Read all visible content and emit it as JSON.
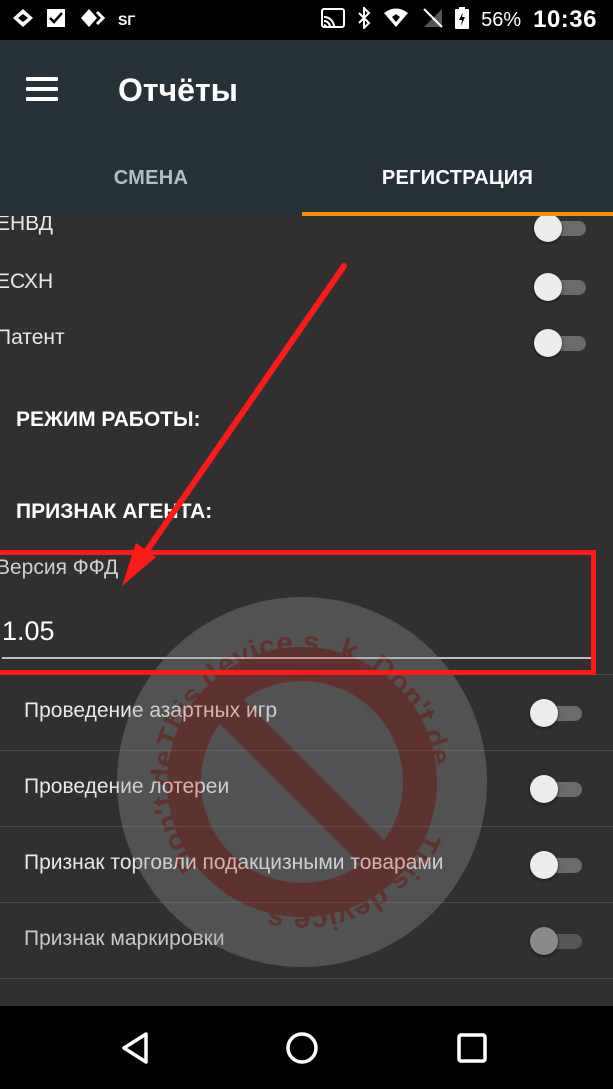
{
  "status_bar": {
    "sim_label": "SГ",
    "battery_percent": "56%",
    "time": "10:36"
  },
  "toolbar": {
    "title": "Отчёты"
  },
  "tabs": [
    {
      "label": "СМЕНА",
      "selected": false
    },
    {
      "label": "РЕГИСТРАЦИЯ",
      "selected": true
    }
  ],
  "tax_systems": [
    {
      "label": "ЕНВД",
      "enabled": false
    },
    {
      "label": "ЕСХН",
      "enabled": false
    },
    {
      "label": "Патент",
      "enabled": false
    }
  ],
  "sections": {
    "work_mode": "РЕЖИМ РАБОТЫ:",
    "agent_sign": "ПРИЗНАК АГЕНТА:"
  },
  "ffd": {
    "label": "Версия ФФД",
    "value": "1.05"
  },
  "options": [
    {
      "label": "Проведение азартных игр",
      "enabled": false
    },
    {
      "label": "Проведение лотереи",
      "enabled": false
    },
    {
      "label": "Признак торговли подакцизными товарами",
      "enabled": false
    },
    {
      "label": "Признак маркировки",
      "enabled": false,
      "disabled": true
    }
  ],
  "watermark": {
    "text_top": "This device s",
    "text_right": "k. Don't de",
    "text_left": "Don't de",
    "text_bottom": "This device s"
  },
  "colors": {
    "toolbar": "#263238",
    "tab_indicator": "#ff8f00",
    "background": "#303030",
    "annotation": "#ff1a1a"
  }
}
